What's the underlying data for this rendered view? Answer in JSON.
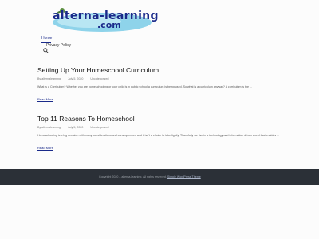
{
  "site": {
    "logo_line1": "alterna-learning",
    "logo_line2": ".com"
  },
  "nav": {
    "home": "Home",
    "privacy": "Privacy Policy"
  },
  "posts": [
    {
      "title": "Setting Up Your Homeschool Curriculum",
      "author": "By alternalearning",
      "date": "July 5, 2020",
      "category": "Uncategorized",
      "excerpt": "What is a Curriculum? Whether you are homeschooling or your child is in public school a curriculum is being used. So what is a curriculum anyway? A curriculum is the ...",
      "read_more": "Read More"
    },
    {
      "title": "Top 11 Reasons To Homeschool",
      "author": "By alternalearning",
      "date": "July 5, 2020",
      "category": "Uncategorized",
      "excerpt": "Homeschooling is a big decision with many considerations and consequences and it isn't a choice to take lightly. Thankfully we live in a technology and information driven world that enables ...",
      "read_more": "Read More"
    }
  ],
  "footer": {
    "copyright": "Copyright 2020 – alterna-learning. All rights reserved.",
    "theme_link": "Simple WordPress Theme"
  }
}
